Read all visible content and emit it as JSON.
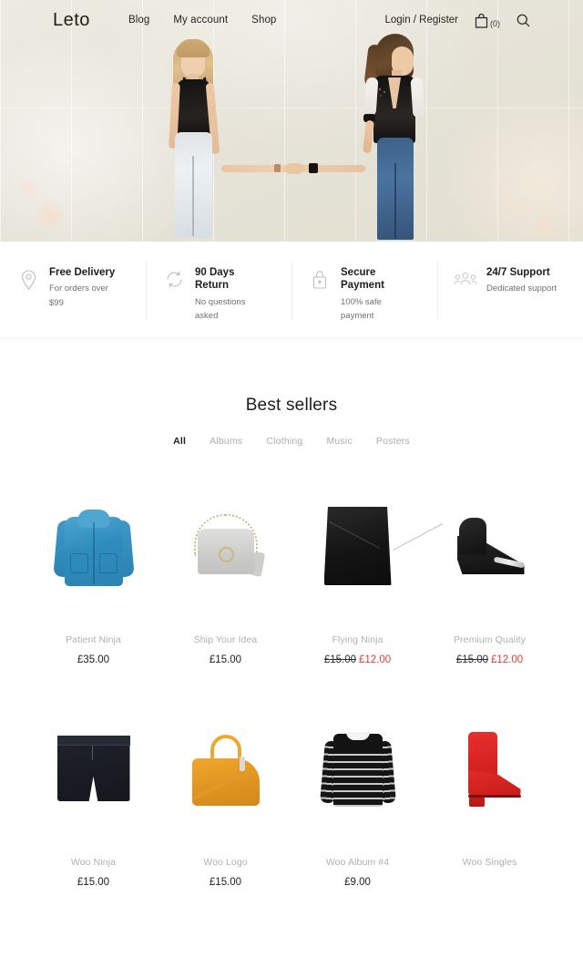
{
  "header": {
    "brand": "Leto",
    "nav": [
      {
        "label": "Blog"
      },
      {
        "label": "My account"
      },
      {
        "label": "Shop"
      }
    ],
    "login_label": "Login / Register",
    "cart_icon": "shopping-bag-icon",
    "cart_count": "(0)",
    "search_icon": "search-icon"
  },
  "hero": {
    "alt": "Two women holding hands in front of a cream tiled wall"
  },
  "features": [
    {
      "icon": "map-pin-icon",
      "title": "Free Delivery",
      "subtitle": "For orders over $99"
    },
    {
      "icon": "return-arrows-icon",
      "title": "90 Days Return",
      "subtitle": "No questions asked"
    },
    {
      "icon": "lock-icon",
      "title": "Secure Payment",
      "subtitle": "100% safe payment"
    },
    {
      "icon": "support-agents-icon",
      "title": "24/7 Support",
      "subtitle": "Dedicated support"
    }
  ],
  "bestsellers": {
    "title": "Best sellers",
    "tabs": [
      {
        "label": "All",
        "active": true
      },
      {
        "label": "Albums",
        "active": false
      },
      {
        "label": "Clothing",
        "active": false
      },
      {
        "label": "Music",
        "active": false
      },
      {
        "label": "Posters",
        "active": false
      }
    ],
    "products": [
      {
        "name": "Patient Ninja",
        "price": "£35.00",
        "old_price": "",
        "sale_price": "",
        "image": "blue-faux-fur-jacket"
      },
      {
        "name": "Ship Your Idea",
        "price": "£15.00",
        "old_price": "",
        "sale_price": "",
        "image": "grey-chain-handbag"
      },
      {
        "name": "Flying Ninja",
        "price": "",
        "old_price": "£15.00",
        "sale_price": "£12.00",
        "image": "black-leather-skirt"
      },
      {
        "name": "Premium Quality",
        "price": "",
        "old_price": "£15.00",
        "sale_price": "£12.00",
        "image": "black-stiletto-heel"
      },
      {
        "name": "Woo Ninja",
        "price": "£15.00",
        "old_price": "",
        "sale_price": "",
        "image": "navy-shorts"
      },
      {
        "name": "Woo Logo",
        "price": "£15.00",
        "old_price": "",
        "sale_price": "",
        "image": "yellow-tote-bag"
      },
      {
        "name": "Woo Album #4",
        "price": "£9.00",
        "old_price": "",
        "sale_price": "",
        "image": "striped-breton-top"
      },
      {
        "name": "Woo Singles",
        "price": "",
        "old_price": "",
        "sale_price": "",
        "image": "red-ankle-boot"
      }
    ]
  },
  "colors": {
    "sale": "#e03a34",
    "text": "#1d1d1b",
    "muted": "#b0b0b0",
    "hero_bg": "#e7e4d9"
  }
}
